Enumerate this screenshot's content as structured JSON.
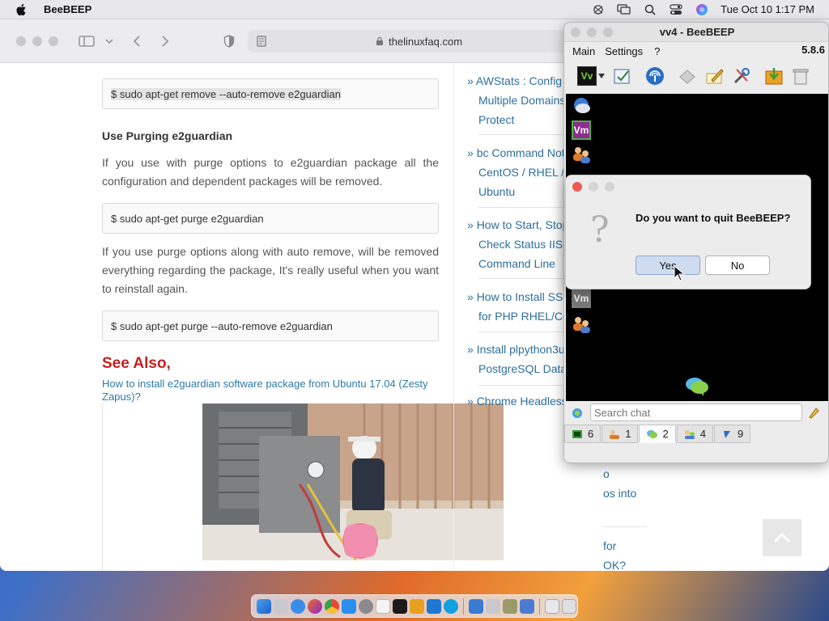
{
  "menubar": {
    "app_name": "BeeBEEP",
    "clock": "Tue Oct 10  1:17 PM"
  },
  "browser": {
    "url": "thelinuxfaq.com"
  },
  "article": {
    "code1": "$ sudo apt-get remove --auto-remove e2guardian",
    "section_title": "Use Purging e2guardian",
    "para1": "If you use with purge options to e2guardian package all the configuration and dependent packages will be removed.",
    "code2": "$ sudo apt-get purge e2guardian",
    "para2": "If you use purge options along with auto remove, will be removed everything regarding the package, It's really useful when you want to reinstall again.",
    "code3": "$ sudo apt-get purge --auto-remove e2guardian",
    "see_also": "See Also,",
    "see_link": "How to install e2guardian software package from Ubuntu 17.04 (Zesty Zapus)?"
  },
  "sidebar": {
    "links": [
      {
        "bullet": "»",
        "first": "AWStats : Config",
        "rest": [
          "Multiple Domains",
          "Protect"
        ]
      },
      {
        "bullet": "»",
        "first": "bc Command Not",
        "rest": [
          "CentOS / RHEL /",
          "Ubuntu"
        ]
      },
      {
        "bullet": "»",
        "first": "How to Start, Stop",
        "rest": [
          "Check Status IIS",
          "Command Line"
        ]
      },
      {
        "bullet": "»",
        "first": "How to Install SSI",
        "rest": [
          "for PHP RHEL/Ce"
        ]
      },
      {
        "bullet": "»",
        "first": "Install plpython3u",
        "rest": [
          "PostgreSQL Data"
        ]
      },
      {
        "bullet": "»",
        "first": "Chrome Headless",
        "rest": []
      }
    ],
    "below": [
      "o",
      "os into",
      "for",
      "OK?"
    ]
  },
  "beebeep": {
    "title": "vv4 - BeeBEEP",
    "menu": [
      "Main",
      "Settings",
      "?"
    ],
    "version": "5.8.6",
    "user_badges": [
      "Vm",
      "Vm"
    ],
    "toolbar_user_badge": "Vv",
    "search_placeholder": "Search chat",
    "tabs": [
      {
        "icon": "users-tab-icon",
        "count": "6"
      },
      {
        "icon": "groups-tab-icon",
        "count": "1"
      },
      {
        "icon": "chats-tab-icon",
        "count": "2",
        "active": true
      },
      {
        "icon": "group-chats-tab-icon",
        "count": "4"
      },
      {
        "icon": "files-tab-icon",
        "count": "9"
      }
    ]
  },
  "dialog": {
    "message": "Do you want to quit BeeBEEP?",
    "yes": "Yes",
    "no": "No"
  },
  "colors": {
    "link": "#2e7aa8",
    "see_also": "#c81e1e",
    "dialog_default": "#cfdcf0"
  }
}
